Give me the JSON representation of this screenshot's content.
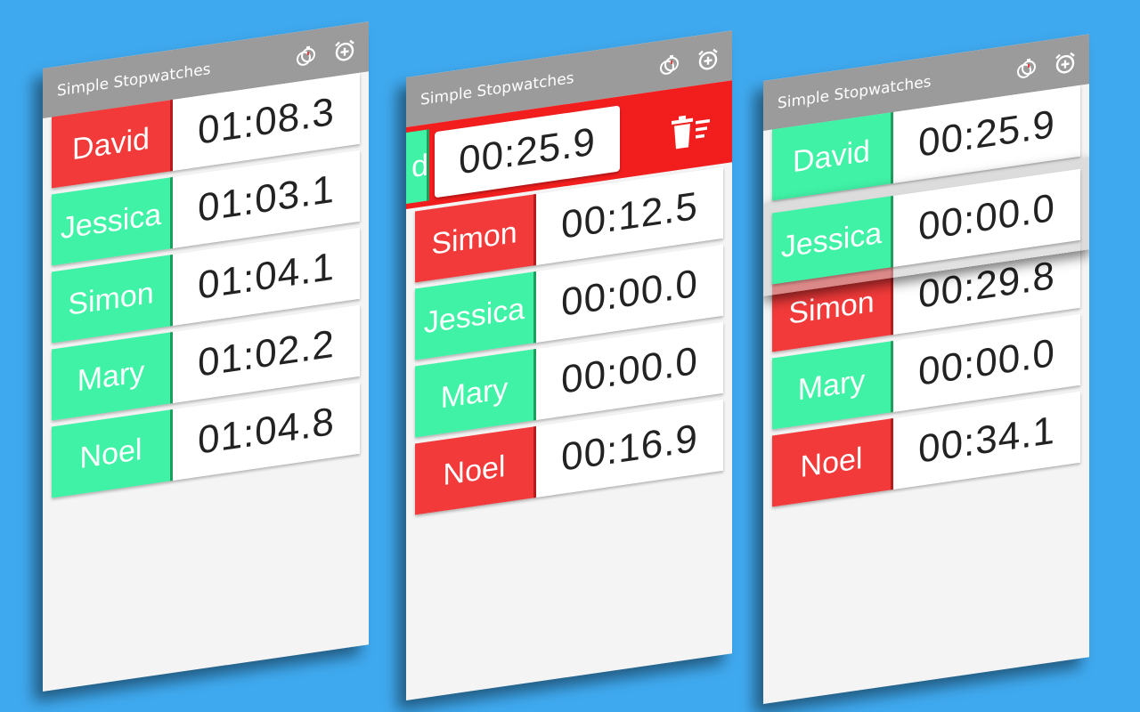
{
  "app": {
    "title": "Simple Stopwatches",
    "icons": [
      "stopwatches-icon",
      "add-alarm-icon"
    ]
  },
  "colors": {
    "background": "#3fa9ef",
    "action_bar": "#9b9b9b",
    "stopped_name": "#3ff2a6",
    "running_name": "#f23a3a",
    "delete_bar": "#f21e1e"
  },
  "screens": [
    {
      "rows": [
        {
          "name": "David",
          "time": "01:08.3",
          "state": "running"
        },
        {
          "name": "Jessica",
          "time": "01:03.1",
          "state": "stopped"
        },
        {
          "name": "Simon",
          "time": "01:04.1",
          "state": "stopped"
        },
        {
          "name": "Mary",
          "time": "01:02.2",
          "state": "stopped"
        },
        {
          "name": "Noel",
          "time": "01:04.8",
          "state": "stopped"
        }
      ]
    },
    {
      "swiped_row": {
        "name": "David",
        "visible_name": "d",
        "time": "00:25.9",
        "state": "stopped"
      },
      "delete_icon": "trash-icon",
      "rows": [
        {
          "name": "Simon",
          "time": "00:12.5",
          "state": "running"
        },
        {
          "name": "Jessica",
          "time": "00:00.0",
          "state": "stopped"
        },
        {
          "name": "Mary",
          "time": "00:00.0",
          "state": "stopped"
        },
        {
          "name": "Noel",
          "time": "00:16.9",
          "state": "running"
        }
      ]
    },
    {
      "rows": [
        {
          "name": "David",
          "time": "00:25.9",
          "state": "stopped"
        },
        {
          "name": "Simon",
          "time": "00:29.8",
          "state": "running"
        },
        {
          "name": "Mary",
          "time": "00:00.0",
          "state": "stopped"
        },
        {
          "name": "Noel",
          "time": "00:34.1",
          "state": "running"
        }
      ],
      "dragged_row": {
        "name": "Jessica",
        "time": "00:00.0",
        "state": "stopped"
      }
    }
  ]
}
